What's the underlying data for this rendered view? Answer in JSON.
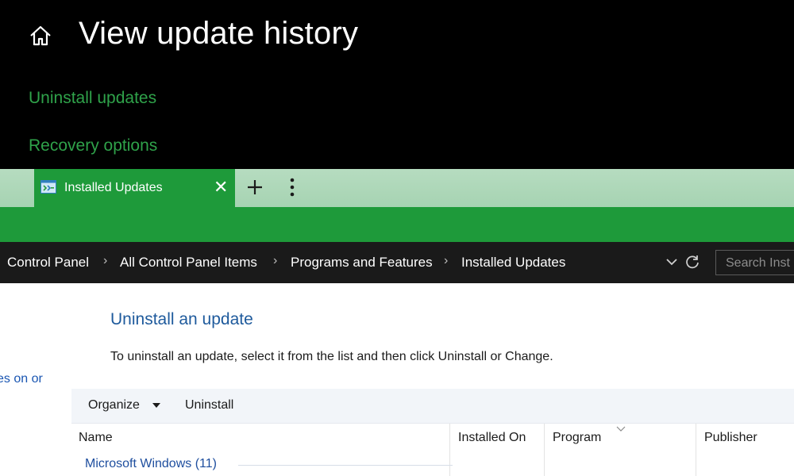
{
  "settings": {
    "title": "View update history",
    "links": {
      "uninstall": "Uninstall updates",
      "recovery": "Recovery options"
    }
  },
  "tab": {
    "label": "Installed Updates",
    "close": "✕"
  },
  "breadcrumbs": [
    "Control Panel",
    "All Control Panel Items",
    "Programs and Features",
    "Installed Updates"
  ],
  "breadcrumb_separator": "›",
  "search": {
    "placeholder": "Search Inst"
  },
  "side_text": "es on or",
  "content": {
    "heading": "Uninstall an update",
    "description": "To uninstall an update, select it from the list and then click Uninstall or Change."
  },
  "toolbar": {
    "organize": "Organize",
    "uninstall": "Uninstall"
  },
  "columns": [
    "Name",
    "Installed On",
    "Program",
    "Publisher"
  ],
  "groups": [
    {
      "label": "Microsoft Windows (11)"
    }
  ],
  "colors": {
    "accent_green": "#1e9a3a",
    "link_green": "#2fa24a",
    "heading_blue": "#1e5a9c"
  },
  "icons": [
    "home-icon",
    "control-panel-icon",
    "close-icon",
    "plus-icon",
    "more-vertical-icon",
    "chevron-down-icon",
    "refresh-icon",
    "caret-down-icon",
    "sort-arrow-icon"
  ]
}
